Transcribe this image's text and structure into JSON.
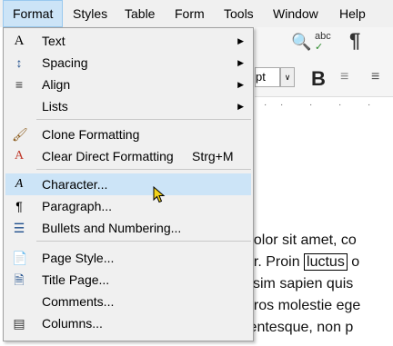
{
  "menubar": {
    "items": [
      {
        "label": "Format",
        "active": true
      },
      {
        "label": "Styles"
      },
      {
        "label": "Table"
      },
      {
        "label": "Form"
      },
      {
        "label": "Tools"
      },
      {
        "label": "Window"
      },
      {
        "label": "Help"
      }
    ]
  },
  "format_menu": {
    "items": [
      {
        "label": "Text",
        "icon": "text-icon",
        "submenu": true
      },
      {
        "label": "Spacing",
        "icon": "spacing-icon",
        "submenu": true
      },
      {
        "label": "Align",
        "icon": "align-icon",
        "submenu": true
      },
      {
        "label": "Lists",
        "icon": "lists-icon",
        "submenu": true
      },
      {
        "label": "Clone Formatting",
        "icon": "clone-formatting-icon"
      },
      {
        "label": "Clear Direct Formatting",
        "icon": "clear-formatting-icon",
        "shortcut": "Strg+M"
      },
      {
        "label": "Character...",
        "icon": "character-icon",
        "highlighted": true
      },
      {
        "label": "Paragraph...",
        "icon": "paragraph-icon"
      },
      {
        "label": "Bullets and Numbering...",
        "icon": "bullets-numbering-icon"
      },
      {
        "label": "Page Style...",
        "icon": "page-style-icon"
      },
      {
        "label": "Title Page...",
        "icon": "title-page-icon"
      },
      {
        "label": "Comments...",
        "icon": ""
      },
      {
        "label": "Columns...",
        "icon": "columns-icon"
      }
    ]
  },
  "toolbar": {
    "font_size_value": "pt",
    "bold": "B"
  },
  "document": {
    "lines": [
      "dolor sit amet, co",
      "er. Proin ",
      "ssim sapien quis",
      "eros molestie ege",
      "lentesque, non p"
    ],
    "boxed_word": "luctus",
    "line2_tail": " o"
  }
}
